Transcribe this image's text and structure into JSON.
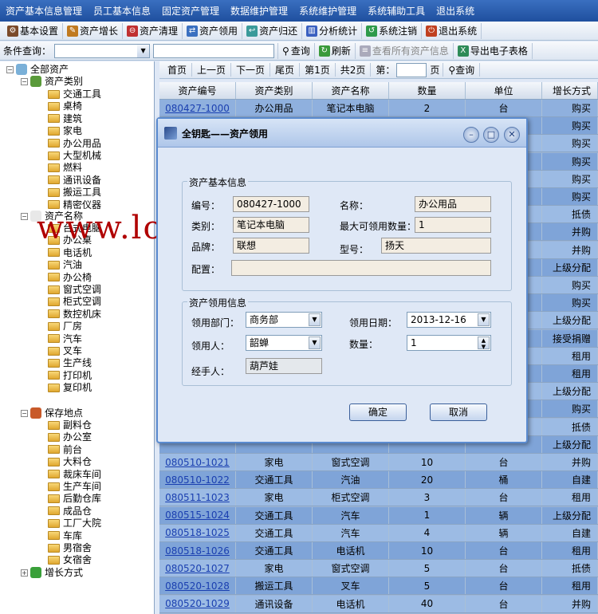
{
  "menu": [
    "资产基本信息管理",
    "员工基本信息",
    "固定资产管理",
    "数据维护管理",
    "系统维护管理",
    "系统辅助工具",
    "退出系统"
  ],
  "toolbar": [
    "基本设置",
    "资产增长",
    "资产清理",
    "资产领用",
    "资产归还",
    "分析统计",
    "系统注销",
    "退出系统"
  ],
  "search": {
    "label": "条件查询：",
    "query_btn": "查询",
    "refresh_btn": "刷新",
    "view_all_btn": "查看所有资产信息",
    "export_btn": "导出电子表格"
  },
  "tree": {
    "root": "全部资产",
    "cat_header": "资产类别",
    "categories": [
      "交通工具",
      "桌椅",
      "建筑",
      "家电",
      "办公用品",
      "大型机械",
      "燃料",
      "通讯设备",
      "搬运工具",
      "精密仪器"
    ],
    "name_header": "资产名称",
    "names": [
      "台式电脑",
      "办公桌",
      "电话机",
      "汽油",
      "办公椅",
      "窗式空调",
      "柜式空调",
      "数控机床",
      "厂房",
      "汽车",
      "叉车",
      "生产线",
      "打印机",
      "复印机"
    ],
    "place_header": "保存地点",
    "places": [
      "副料仓",
      "办公室",
      "前台",
      "大料仓",
      "裁床车间",
      "生产车间",
      "后勤仓库",
      "成品仓",
      "工厂大院",
      "车库",
      "男宿舍",
      "女宿舍"
    ],
    "growth_header": "增长方式"
  },
  "pager": {
    "first": "首页",
    "prev": "上一页",
    "next": "下一页",
    "last": "尾页",
    "cur": "第1页",
    "total": "共2页",
    "goto_prefix": "第：",
    "goto_suffix": "页",
    "query": "查询"
  },
  "grid": {
    "headers": [
      "资产编号",
      "资产类别",
      "资产名称",
      "数量",
      "单位",
      "增长方式"
    ],
    "rows": [
      [
        "080427-1000",
        "办公用品",
        "笔记本电脑",
        "2",
        "台",
        "购买"
      ],
      [
        "",
        "",
        "",
        "",
        "",
        "购买"
      ],
      [
        "",
        "",
        "",
        "",
        "",
        "购买"
      ],
      [
        "",
        "",
        "",
        "",
        "",
        "购买"
      ],
      [
        "",
        "",
        "",
        "",
        "",
        "购买"
      ],
      [
        "",
        "",
        "",
        "",
        "",
        "购买"
      ],
      [
        "",
        "",
        "",
        "",
        "",
        "抵债"
      ],
      [
        "",
        "",
        "",
        "",
        "",
        "并购"
      ],
      [
        "",
        "",
        "",
        "",
        "",
        "并购"
      ],
      [
        "",
        "",
        "",
        "",
        "",
        "上级分配"
      ],
      [
        "",
        "",
        "",
        "",
        "",
        "购买"
      ],
      [
        "",
        "",
        "",
        "",
        "",
        "购买"
      ],
      [
        "",
        "",
        "",
        "",
        "",
        "上级分配"
      ],
      [
        "",
        "",
        "",
        "",
        "",
        "接受捐赠"
      ],
      [
        "",
        "",
        "",
        "",
        "",
        "租用"
      ],
      [
        "",
        "",
        "",
        "",
        "",
        "租用"
      ],
      [
        "",
        "",
        "",
        "",
        "",
        "上级分配"
      ],
      [
        "",
        "",
        "",
        "",
        "",
        "购买"
      ],
      [
        "",
        "",
        "",
        "",
        "",
        "抵债"
      ],
      [
        "",
        "",
        "",
        "",
        "",
        "上级分配"
      ],
      [
        "080510-1021",
        "家电",
        "窗式空调",
        "10",
        "台",
        "并购"
      ],
      [
        "080510-1022",
        "交通工具",
        "汽油",
        "20",
        "桶",
        "自建"
      ],
      [
        "080511-1023",
        "家电",
        "柜式空调",
        "3",
        "台",
        "租用"
      ],
      [
        "080515-1024",
        "交通工具",
        "汽车",
        "1",
        "辆",
        "上级分配"
      ],
      [
        "080518-1025",
        "交通工具",
        "汽车",
        "4",
        "辆",
        "自建"
      ],
      [
        "080518-1026",
        "交通工具",
        "电话机",
        "10",
        "台",
        "租用"
      ],
      [
        "080520-1027",
        "家电",
        "窗式空调",
        "5",
        "台",
        "抵债"
      ],
      [
        "080520-1028",
        "搬运工具",
        "叉车",
        "5",
        "台",
        "租用"
      ],
      [
        "080520-1029",
        "通讯设备",
        "电话机",
        "40",
        "台",
        "并购"
      ]
    ]
  },
  "dialog": {
    "title": "全钥匙——资产领用",
    "basic_group": "资产基本信息",
    "id_label": "编号：",
    "id_value": "080427-1000",
    "name_label": "名称：",
    "name_value": "办公用品",
    "cat_label": "类别：",
    "cat_value": "笔记本电脑",
    "max_label": "最大可领用数量：",
    "max_value": "1",
    "brand_label": "品牌：",
    "brand_value": "联想",
    "model_label": "型号：",
    "model_value": "扬天",
    "config_label": "配置：",
    "config_value": "",
    "use_group": "资产领用信息",
    "dept_label": "领用部门：",
    "dept_value": "商务部",
    "date_label": "领用日期：",
    "date_value": "2013-12-16",
    "person_label": "领用人：",
    "person_value": "韶蝉",
    "qty_label": "数量：",
    "qty_value": "1",
    "handler_label": "经手人：",
    "handler_value": "葫芦娃",
    "ok": "确定",
    "cancel": "取消"
  },
  "watermark": "www.lovetw.cn"
}
